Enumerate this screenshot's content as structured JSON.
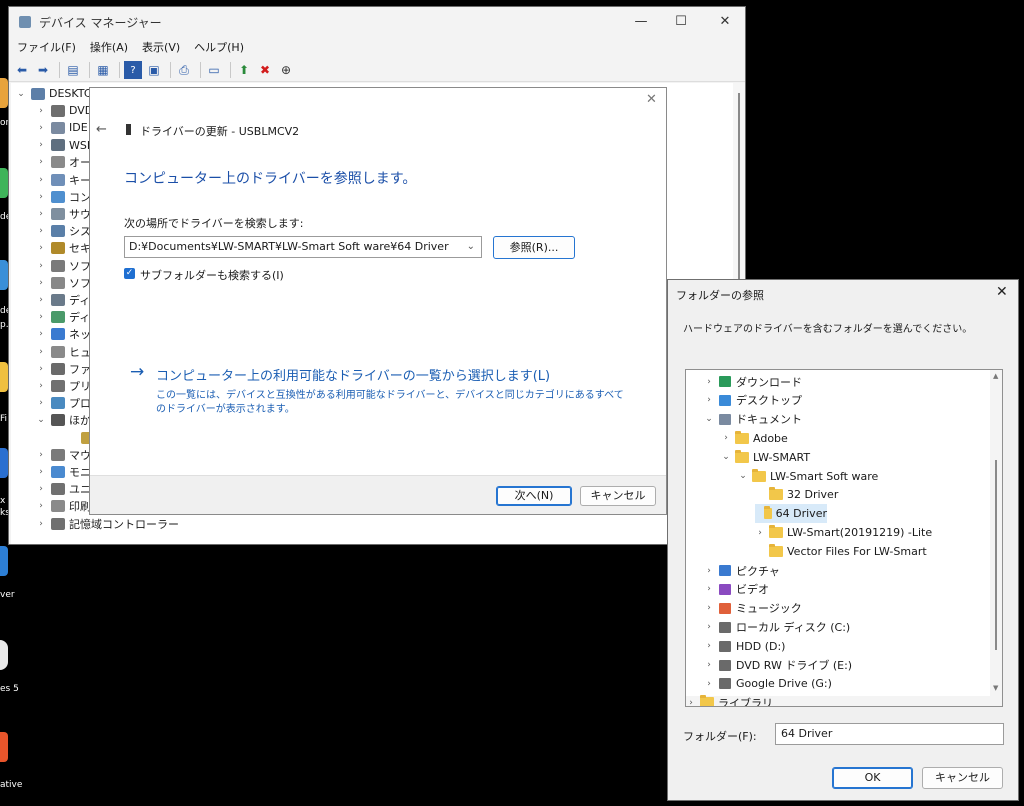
{
  "desktop": {
    "labels": [
      "or",
      "de",
      "de",
      "p...",
      "Fi",
      "x",
      "ks",
      "ver",
      "es 5",
      "ative"
    ]
  },
  "devmgr": {
    "title": "デバイス マネージャー",
    "controls": {
      "minimize": "—",
      "maximize": "☐",
      "close": "✕"
    },
    "menu": [
      "ファイル(F)",
      "操作(A)",
      "表示(V)",
      "ヘルプ(H)"
    ],
    "tree": [
      {
        "label": "DESKTC",
        "chev": "⌄"
      },
      {
        "label": "DVD",
        "chev": "›"
      },
      {
        "label": "IDE",
        "chev": "›"
      },
      {
        "label": "WSI",
        "chev": "›"
      },
      {
        "label": "オー",
        "chev": "›"
      },
      {
        "label": "キー",
        "chev": "›"
      },
      {
        "label": "コン",
        "chev": "›"
      },
      {
        "label": "サウ",
        "chev": "›"
      },
      {
        "label": "シス",
        "chev": "›"
      },
      {
        "label": "セキ",
        "chev": "›"
      },
      {
        "label": "ソフ",
        "chev": "›"
      },
      {
        "label": "ソフ",
        "chev": "›"
      },
      {
        "label": "ディ",
        "chev": "›"
      },
      {
        "label": "ディ",
        "chev": "›"
      },
      {
        "label": "ネッ",
        "chev": "›"
      },
      {
        "label": "ヒュ",
        "chev": "›"
      },
      {
        "label": "ファ",
        "chev": "›"
      },
      {
        "label": "プリ",
        "chev": "›"
      },
      {
        "label": "プロ",
        "chev": "›"
      },
      {
        "label": "ほか",
        "chev": "⌄"
      },
      {
        "label": "",
        "chev": ""
      },
      {
        "label": "マウ",
        "chev": "›"
      },
      {
        "label": "モニ",
        "chev": "›"
      },
      {
        "label": "ユニ",
        "chev": "›"
      },
      {
        "label": "印刷",
        "chev": "›"
      },
      {
        "label": "記憶域コントローラー",
        "chev": "›"
      }
    ]
  },
  "update_dialog": {
    "header": "ドライバーの更新 - USBLMCV2",
    "heading": "コンピューター上のドライバーを参照します。",
    "search_label": "次の場所でドライバーを検索します:",
    "path": "D:¥Documents¥LW-SMART¥LW-Smart Soft ware¥64 Driver",
    "browse_button": "参照(R)...",
    "include_subfolders": "サブフォルダーも検索する(I)",
    "pick_link": "コンピューター上の利用可能なドライバーの一覧から選択します(L)",
    "pick_desc_1": "この一覧には、デバイスと互換性がある利用可能なドライバーと、デバイスと同じカテゴリにあるすべて",
    "pick_desc_2": "のドライバーが表示されます。",
    "next_button": "次へ(N)",
    "cancel_button": "キャンセル",
    "close": "✕",
    "back": "←"
  },
  "browse_dialog": {
    "title": "フォルダーの参照",
    "close": "✕",
    "instruction": "ハードウェアのドライバーを含むフォルダーを選んでください。",
    "items": [
      {
        "label": "ダウンロード",
        "indent": 0,
        "chev": "›",
        "icon": "download-icon"
      },
      {
        "label": "デスクトップ",
        "indent": 0,
        "chev": "›",
        "icon": "desktop-icon"
      },
      {
        "label": "ドキュメント",
        "indent": 0,
        "chev": "⌄",
        "icon": "documents-icon"
      },
      {
        "label": "Adobe",
        "indent": 1,
        "chev": "›",
        "icon": "folder-icon"
      },
      {
        "label": "LW-SMART",
        "indent": 1,
        "chev": "⌄",
        "icon": "folder-icon"
      },
      {
        "label": "LW-Smart Soft ware",
        "indent": 2,
        "chev": "⌄",
        "icon": "folder-icon"
      },
      {
        "label": "32 Driver",
        "indent": 3,
        "chev": "",
        "icon": "folder-icon"
      },
      {
        "label": "64 Driver",
        "indent": 3,
        "chev": "",
        "icon": "folder-icon",
        "selected": true
      },
      {
        "label": "LW-Smart(20191219) -Lite",
        "indent": 3,
        "chev": "›",
        "icon": "folder-icon"
      },
      {
        "label": "Vector Files For LW-Smart",
        "indent": 3,
        "chev": "",
        "icon": "folder-icon"
      },
      {
        "label": "ピクチャ",
        "indent": 0,
        "chev": "›",
        "icon": "pictures-icon"
      },
      {
        "label": "ビデオ",
        "indent": 0,
        "chev": "›",
        "icon": "videos-icon"
      },
      {
        "label": "ミュージック",
        "indent": 0,
        "chev": "›",
        "icon": "music-icon"
      },
      {
        "label": "ローカル ディスク (C:)",
        "indent": 0,
        "chev": "›",
        "icon": "drive-icon"
      },
      {
        "label": "HDD (D:)",
        "indent": 0,
        "chev": "›",
        "icon": "drive-icon"
      },
      {
        "label": "DVD RW ドライブ (E:)",
        "indent": 0,
        "chev": "›",
        "icon": "dvd-drive-icon"
      },
      {
        "label": "Google Drive (G:)",
        "indent": 0,
        "chev": "›",
        "icon": "drive-icon"
      },
      {
        "label": "ライブラリ",
        "indent": -1,
        "chev": "›",
        "icon": "folder-icon"
      }
    ],
    "folder_label": "フォルダー(F):",
    "folder_value": "64 Driver",
    "ok_button": "OK",
    "cancel_button": "キャンセル"
  }
}
